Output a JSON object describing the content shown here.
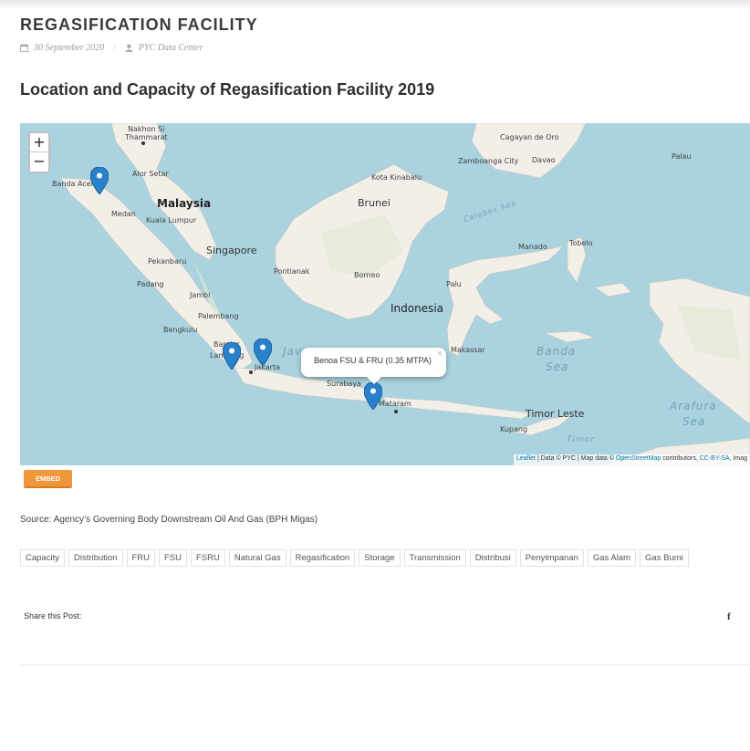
{
  "post": {
    "title": "REGASIFICATION FACILITY",
    "date": "30 September 2020",
    "separator": "/",
    "author": "PYC Data Center"
  },
  "section_title": "Location and Capacity of Regasification Facility 2019",
  "map": {
    "zoom_in": "+",
    "zoom_out": "−",
    "labels": {
      "nakhon": "Nakhon Si",
      "thammarat": "Thammarat",
      "alor_setar": "Alor Setar",
      "banda_aceh": "Banda Aceh",
      "malaysia": "Malaysia",
      "medan": "Medan",
      "kuala_lumpur": "Kuala Lumpur",
      "singapore": "Singapore",
      "pekanbaru": "Pekanbaru",
      "padang": "Padang",
      "jambi": "Jambi",
      "palembang": "Palembang",
      "bengkulu": "Bengkulu",
      "bandar": "Bandar",
      "lampung": "Lampung",
      "jakarta": "Jakarta",
      "kota_kinabalu": "Kota Kinabalu",
      "brunei": "Brunei",
      "pontianak": "Pontianak",
      "borneo": "Borneo",
      "indonesia": "Indonesia",
      "palu": "Palu",
      "makassar": "Makassar",
      "surabaya": "Surabaya",
      "mataram": "Mataram",
      "kupang": "Kupang",
      "timor_leste": "Timor Leste",
      "timor": "Timor",
      "cagayan": "Cagayan de Oro",
      "zamboanga": "Zamboanga City",
      "davao": "Davao",
      "palau": "Palau",
      "manado": "Manado",
      "tobelo": "Tobelo",
      "celebes_sea": "Celebes Sea",
      "banda_sea_1": "Banda",
      "banda_sea_2": "Sea",
      "arafura_1": "Arafura",
      "arafura_2": "Sea",
      "java_sea": "Jav"
    },
    "popup": {
      "text": "Benoa FSU & FRU (0.35 MTPA)",
      "close": "×"
    },
    "attribution": {
      "leaflet": "Leaflet",
      "sep1": " | Data © PYC | Map data © ",
      "osm": "OpenStreetMap",
      "contrib": " contributors, ",
      "license": "CC-BY-SA",
      "imagery": ", Imag"
    },
    "colors": {
      "water": "#aad3df",
      "land": "#f2efe9",
      "marker": "#2a81cb"
    }
  },
  "embed_label": "EMBED",
  "source": "Source: Agency’s Governing Body Downstream Oil And Gas (BPH Migas)",
  "tags": [
    "Capacity",
    "Distribution",
    "FRU",
    "FSU",
    "FSRU",
    "Natural Gas",
    "Regasification",
    "Storage",
    "Transmission",
    "Distribusi",
    "Penyimpanan",
    "Gas Alam",
    "Gas Bumi"
  ],
  "share_label": "Share this Post:",
  "facebook_icon": "f"
}
